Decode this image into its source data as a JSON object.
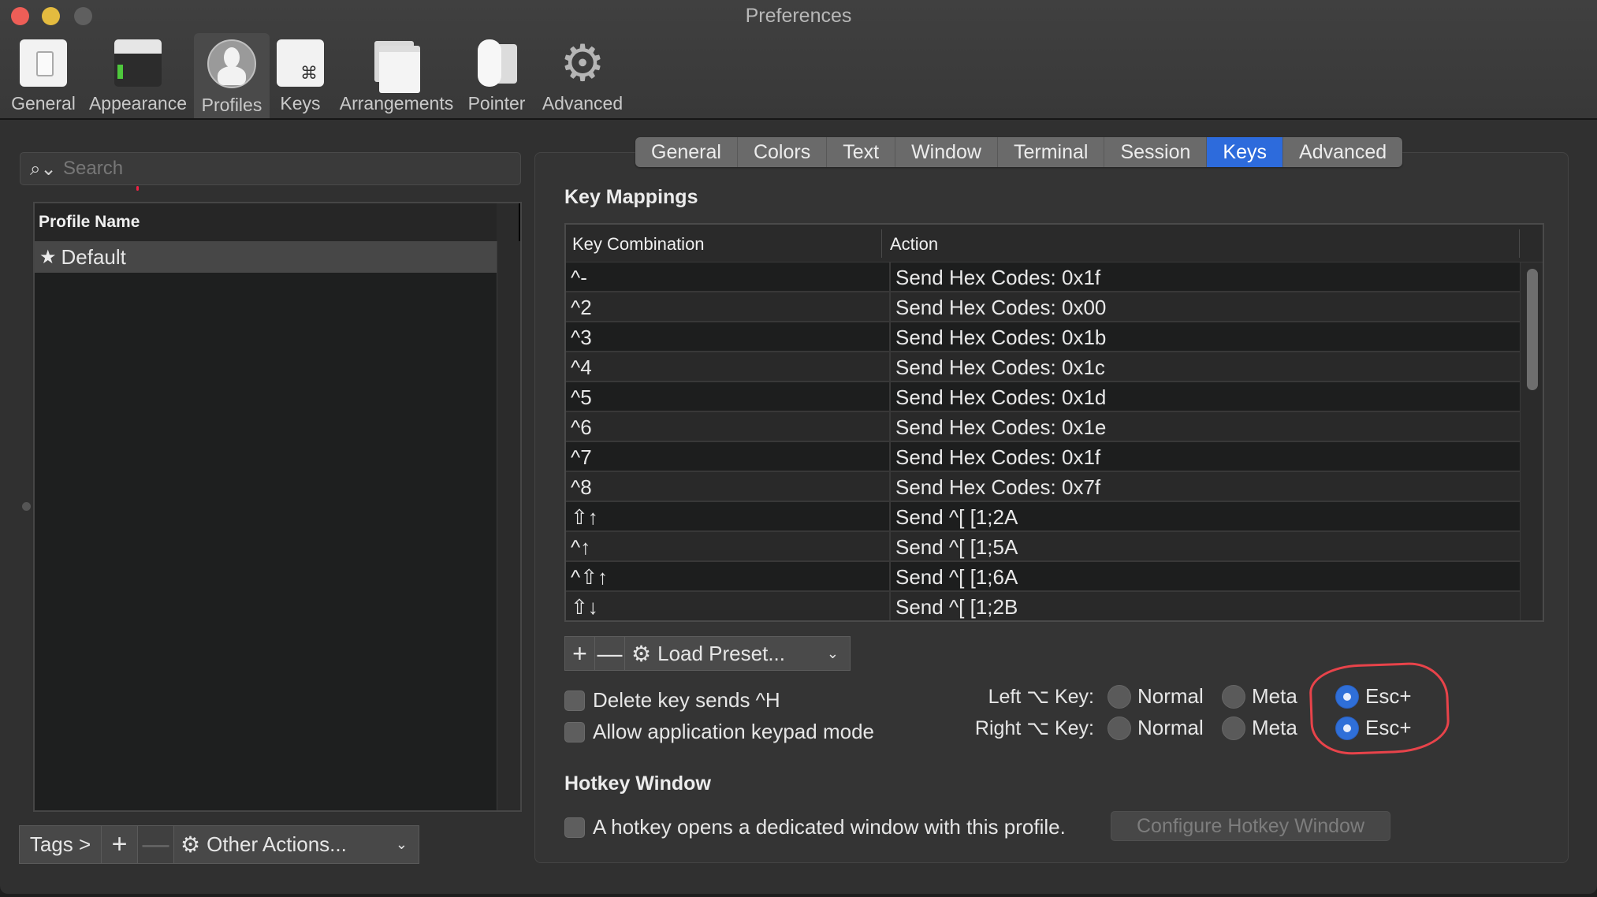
{
  "window": {
    "title": "Preferences"
  },
  "toolbar": {
    "items": [
      {
        "label": "General",
        "icon": "general-switch-icon"
      },
      {
        "label": "Appearance",
        "icon": "appearance-terminal-icon"
      },
      {
        "label": "Profiles",
        "icon": "profile-person-icon",
        "selected": true
      },
      {
        "label": "Keys",
        "icon": "keys-command-icon"
      },
      {
        "label": "Arrangements",
        "icon": "arrangements-windows-icon"
      },
      {
        "label": "Pointer",
        "icon": "pointer-mouse-icon"
      },
      {
        "label": "Advanced",
        "icon": "advanced-gear-icon"
      }
    ]
  },
  "sidebar": {
    "search": {
      "placeholder": "Search",
      "value": "",
      "icon": "⌕⌄"
    },
    "table": {
      "header": "Profile Name",
      "rows": [
        {
          "name": "Default",
          "icon": "★",
          "selected": true
        }
      ]
    },
    "bottom_bar": {
      "tags_label": "Tags >",
      "add_label": "+",
      "remove_label": "—",
      "actions_icon": "⚙",
      "actions_label": "Other Actions...",
      "chevron": "⌄"
    }
  },
  "tabs": {
    "items": [
      "General",
      "Colors",
      "Text",
      "Window",
      "Terminal",
      "Session",
      "Keys",
      "Advanced"
    ],
    "active": "Keys"
  },
  "key_mappings": {
    "title": "Key Mappings",
    "columns": [
      "Key Combination",
      "Action"
    ],
    "rows": [
      {
        "key": "^-",
        "action": "Send Hex Codes: 0x1f"
      },
      {
        "key": "^2",
        "action": "Send Hex Codes: 0x00"
      },
      {
        "key": "^3",
        "action": "Send Hex Codes: 0x1b"
      },
      {
        "key": "^4",
        "action": "Send Hex Codes: 0x1c"
      },
      {
        "key": "^5",
        "action": "Send Hex Codes: 0x1d"
      },
      {
        "key": "^6",
        "action": "Send Hex Codes: 0x1e"
      },
      {
        "key": "^7",
        "action": "Send Hex Codes: 0x1f"
      },
      {
        "key": "^8",
        "action": "Send Hex Codes: 0x7f"
      },
      {
        "key": "⇧↑",
        "action": "Send ^[ [1;2A"
      },
      {
        "key": "^↑",
        "action": "Send ^[ [1;5A"
      },
      {
        "key": "^⇧↑",
        "action": "Send ^[ [1;6A"
      },
      {
        "key": "⇧↓",
        "action": "Send ^[ [1;2B"
      }
    ],
    "add_label": "+",
    "remove_label": "—",
    "preset_icon": "⚙",
    "preset_label": "Load Preset...",
    "preset_chevron": "⌄"
  },
  "options": {
    "delete_sends_ctrl_h": {
      "label": "Delete key sends ^H",
      "checked": false
    },
    "app_keypad_mode": {
      "label": "Allow application keypad mode",
      "checked": false
    },
    "left_option": {
      "label": "Left ⌥ Key:",
      "choices": [
        "Normal",
        "Meta",
        "Esc+"
      ],
      "selected": "Esc+"
    },
    "right_option": {
      "label": "Right ⌥ Key:",
      "choices": [
        "Normal",
        "Meta",
        "Esc+"
      ],
      "selected": "Esc+"
    }
  },
  "hotkey": {
    "title": "Hotkey Window",
    "checkbox_label": "A hotkey opens a dedicated window with this profile.",
    "checked": false,
    "configure_label": "Configure Hotkey Window"
  },
  "colors": {
    "accent": "#2d6bdc",
    "radio_selected": "#2f6fd8",
    "annotation": "#e8434a"
  }
}
